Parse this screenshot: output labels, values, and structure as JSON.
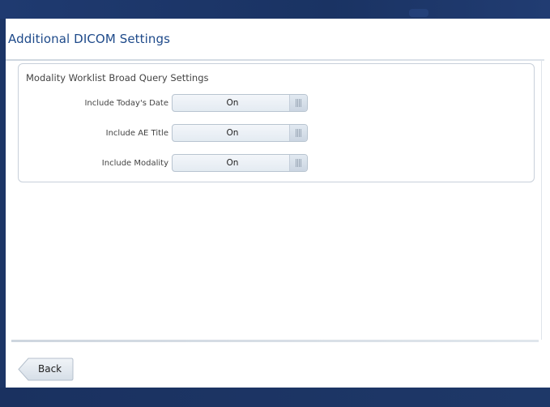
{
  "header": {
    "title": "Additional DICOM Settings"
  },
  "group": {
    "title": "Modality Worklist Broad Query Settings",
    "settings": [
      {
        "label": "Include Today's Date",
        "value": "On"
      },
      {
        "label": "Include AE Title",
        "value": "On"
      },
      {
        "label": "Include Modality",
        "value": "On"
      }
    ]
  },
  "footer": {
    "back_label": "Back"
  },
  "icons": {
    "toggle_handle": "grip-lines-icon",
    "back_arrow": "back-arrow-shape"
  },
  "colors": {
    "frame": "#1c3566",
    "title": "#1e4a8a",
    "panel": "#ffffff",
    "toggle_border": "#b8c4d0"
  }
}
